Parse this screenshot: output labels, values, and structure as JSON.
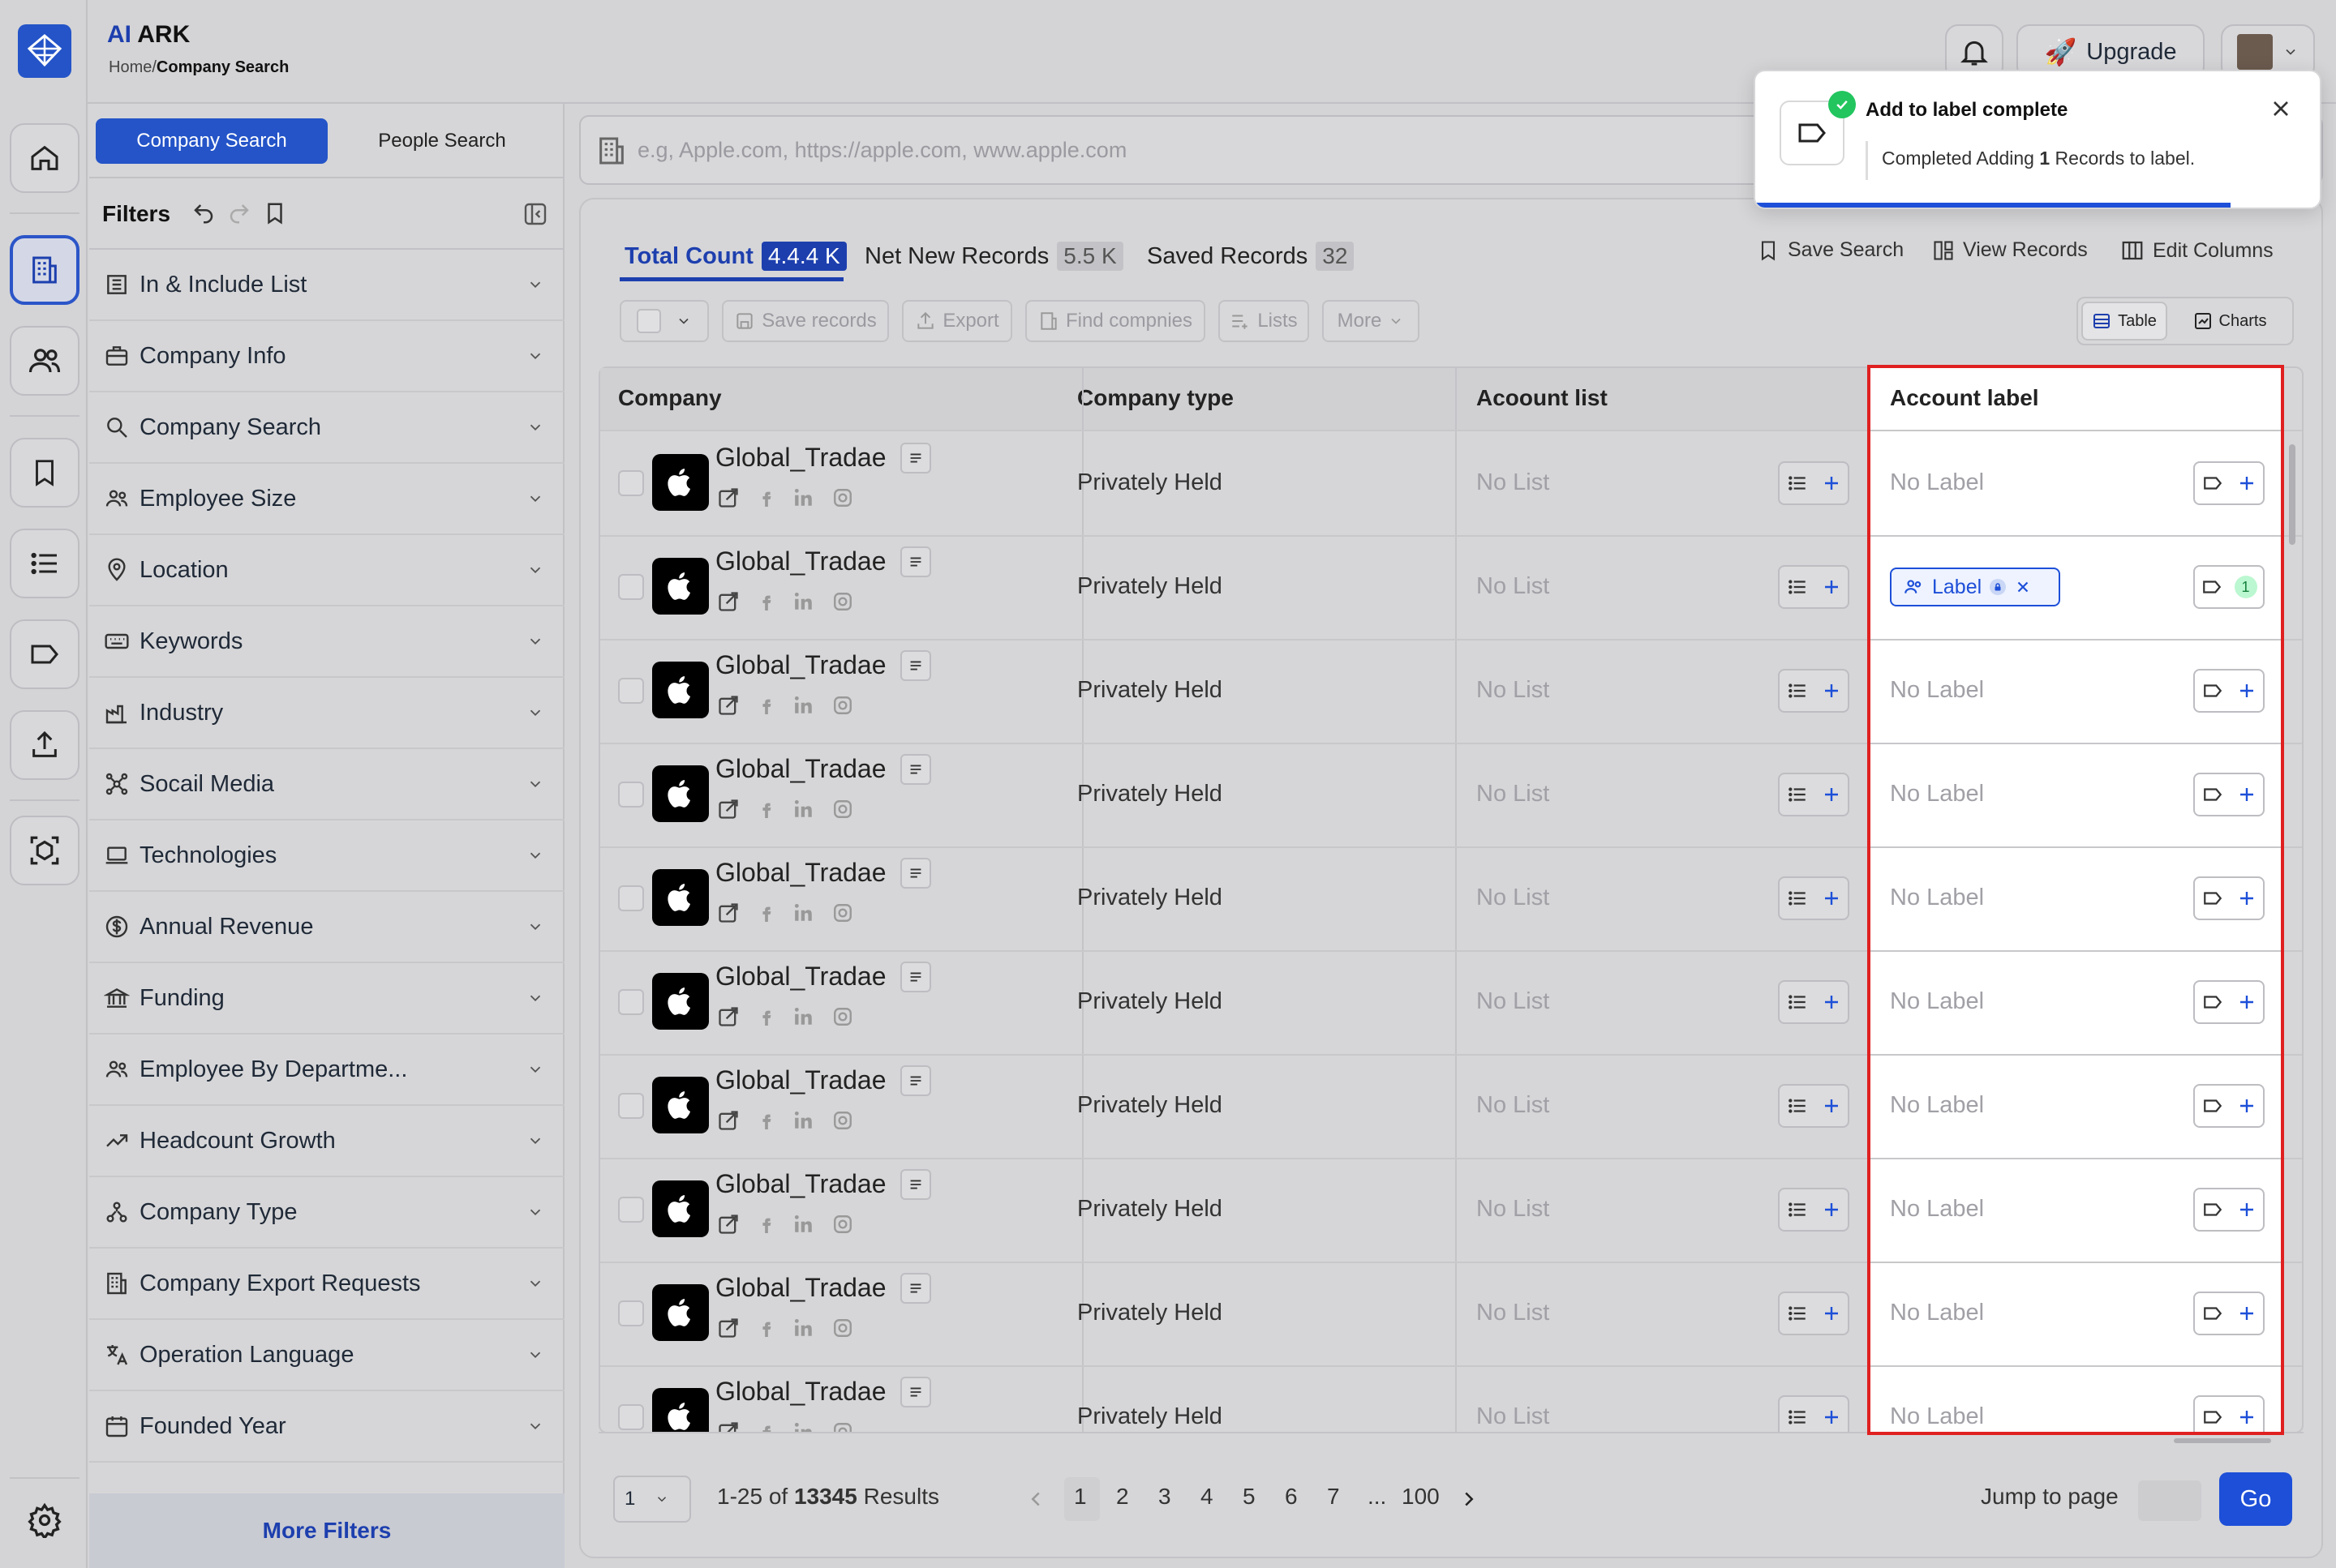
{
  "app": {
    "brand_ai": "AI",
    "brand_rest": "ARK"
  },
  "breadcrumb": {
    "home": "Home/",
    "current": "Company Search"
  },
  "header": {
    "upgrade_label": "Upgrade"
  },
  "search_tabs": {
    "company": "Company Search",
    "people": "People Search"
  },
  "filters": {
    "title": "Filters",
    "items": [
      {
        "label": "In & Include List",
        "icon": "list-icon"
      },
      {
        "label": "Company Info",
        "icon": "briefcase-icon"
      },
      {
        "label": "Company Search",
        "icon": "search-icon"
      },
      {
        "label": "Employee Size",
        "icon": "people-icon"
      },
      {
        "label": "Location",
        "icon": "location-pin-icon"
      },
      {
        "label": "Keywords",
        "icon": "keyboard-icon"
      },
      {
        "label": "Industry",
        "icon": "factory-icon"
      },
      {
        "label": "Socail Media",
        "icon": "network-icon"
      },
      {
        "label": "Technologies",
        "icon": "laptop-icon"
      },
      {
        "label": "Annual Revenue",
        "icon": "dollar-icon"
      },
      {
        "label": "Funding",
        "icon": "bank-icon"
      },
      {
        "label": "Employee By Departme...",
        "icon": "people-icon"
      },
      {
        "label": "Headcount Growth",
        "icon": "trend-icon"
      },
      {
        "label": "Company Type",
        "icon": "hierarchy-icon"
      },
      {
        "label": "Company Export Requests",
        "icon": "building-icon"
      },
      {
        "label": "Operation Language",
        "icon": "translate-icon"
      },
      {
        "label": "Founded Year",
        "icon": "calendar-icon"
      }
    ],
    "more_label": "More Filters"
  },
  "search": {
    "placeholder": "e.g, Apple.com, https://apple.com, www.apple.com"
  },
  "count_tabs": [
    {
      "label": "Total Count",
      "count": "4.4.4 K"
    },
    {
      "label": "Net New Records",
      "count": "5.5 K"
    },
    {
      "label": "Saved Records",
      "count": "32"
    }
  ],
  "actions": {
    "save_search": "Save Search",
    "view_records": "View Records",
    "edit_columns": "Edit Columns"
  },
  "toolbar": {
    "save_records": "Save records",
    "export": "Export",
    "find_companies": "Find compnies",
    "lists": "Lists",
    "more": "More",
    "table": "Table",
    "charts": "Charts"
  },
  "table": {
    "headers": {
      "company": "Company",
      "type": "Company type",
      "list": "Acoount list",
      "label": "Account label"
    },
    "rows": [
      {
        "name": "Global_Tradae",
        "type": "Privately Held",
        "list": "No List",
        "label": "No Label"
      },
      {
        "name": "Global_Tradae",
        "type": "Privately Held",
        "list": "No List",
        "label": "Label",
        "label_count": "1"
      },
      {
        "name": "Global_Tradae",
        "type": "Privately Held",
        "list": "No List",
        "label": "No Label"
      },
      {
        "name": "Global_Tradae",
        "type": "Privately Held",
        "list": "No List",
        "label": "No Label"
      },
      {
        "name": "Global_Tradae",
        "type": "Privately Held",
        "list": "No List",
        "label": "No Label"
      },
      {
        "name": "Global_Tradae",
        "type": "Privately Held",
        "list": "No List",
        "label": "No Label"
      },
      {
        "name": "Global_Tradae",
        "type": "Privately Held",
        "list": "No List",
        "label": "No Label"
      },
      {
        "name": "Global_Tradae",
        "type": "Privately Held",
        "list": "No List",
        "label": "No Label"
      },
      {
        "name": "Global_Tradae",
        "type": "Privately Held",
        "list": "No List",
        "label": "No Label"
      },
      {
        "name": "Global_Tradae",
        "type": "Privately Held",
        "list": "No List",
        "label": "No Label"
      }
    ]
  },
  "pagination": {
    "page_size": "1",
    "range": "1-25 of",
    "total": "13345",
    "results_word": "Results",
    "pages": [
      "1",
      "2",
      "3",
      "4",
      "5",
      "6",
      "7"
    ],
    "ellipsis": "...",
    "last": "100",
    "jump_label": "Jump to page",
    "go": "Go"
  },
  "toast": {
    "title": "Add to label complete",
    "msg_pre": "Completed Adding",
    "msg_count": "1",
    "msg_post": "Records to label."
  },
  "colors": {
    "accent": "#1d3fae",
    "highlight": "#e02020",
    "success": "#22c55e"
  }
}
